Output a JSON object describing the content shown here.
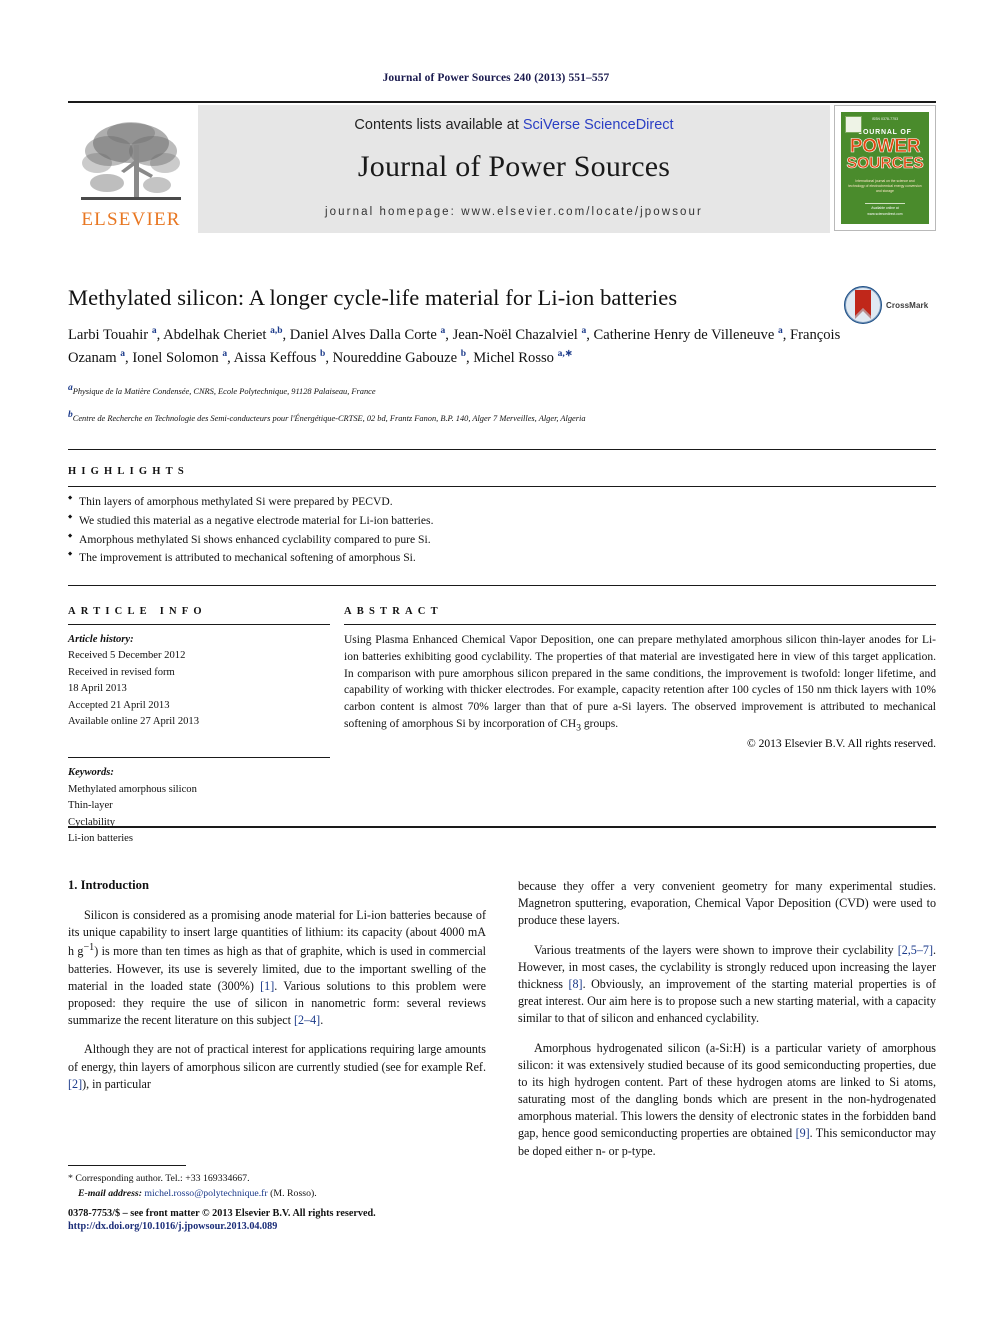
{
  "running_head": "Journal of Power Sources 240 (2013) 551–557",
  "masthead": {
    "publisher_logo_name": "elsevier-tree-logo",
    "publisher_wordmark": "ELSEVIER",
    "contents_prefix": "Contents lists available at ",
    "contents_link": "SciVerse ScienceDirect",
    "journal_name": "Journal of Power Sources",
    "homepage_line": "journal homepage: www.elsevier.com/locate/jpowsour",
    "cover": {
      "top_text": "ISSN 0378-7753",
      "line1": "JOURNAL OF",
      "line2": "POWER",
      "line3": "SOURCES",
      "blurb": "International journal on the science and technology of electrochemical energy conversion and storage",
      "bottom_line1": "Available online at",
      "bottom_line2": "www.sciencedirect.com"
    },
    "accent_orange": "#E87722",
    "link_blue": "#2b3fc4",
    "contents_bg": "#e6e6e6",
    "cover_green": "#4a8b2c"
  },
  "article": {
    "title": "Methylated silicon: A longer cycle-life material for Li-ion batteries",
    "crossmark_label": "CrossMark",
    "authors_html": "Larbi Touahir <sup>a</sup>, Abdelhak Cheriet <sup>a,b</sup>, Daniel Alves Dalla Corte <sup>a</sup>, Jean-Noël Chazalviel <sup>a</sup>, Catherine Henry de Villeneuve <sup>a</sup>, François Ozanam <sup>a</sup>, Ionel Solomon <sup>a</sup>, Aissa Keffous <sup>b</sup>, Noureddine Gabouze <sup>b</sup>, Michel Rosso <sup>a,∗</sup>",
    "affiliation_a": "Physique de la Matière Condensée, CNRS, Ecole Polytechnique, 91128 Palaiseau, France",
    "affiliation_b": "Centre de Recherche en Technologie des Semi-conducteurs pour l'Énergétique-CRTSE, 02 bd, Frantz Fanon, B.P. 140, Alger 7 Merveilles, Alger, Algeria"
  },
  "highlights": {
    "heading": "HIGHLIGHTS",
    "items": [
      "Thin layers of amorphous methylated Si were prepared by PECVD.",
      "We studied this material as a negative electrode material for Li-ion batteries.",
      "Amorphous methylated Si shows enhanced cyclability compared to pure Si.",
      "The improvement is attributed to mechanical softening of amorphous Si."
    ]
  },
  "article_info": {
    "heading": "ARTICLE INFO",
    "history_label": "Article history:",
    "history": [
      "Received 5 December 2012",
      "Received in revised form",
      "18 April 2013",
      "Accepted 21 April 2013",
      "Available online 27 April 2013"
    ],
    "keywords_label": "Keywords:",
    "keywords": [
      "Methylated amorphous silicon",
      "Thin-layer",
      "Cyclability",
      "Li-ion batteries"
    ]
  },
  "abstract": {
    "heading": "ABSTRACT",
    "text_html": "Using Plasma Enhanced Chemical Vapor Deposition, one can prepare methylated amorphous silicon thin-layer anodes for Li-ion batteries exhibiting good cyclability. The properties of that material are investigated here in view of this target application. In comparison with pure amorphous silicon prepared in the same conditions, the improvement is twofold: longer lifetime, and capability of working with thicker electrodes. For example, capacity retention after 100 cycles of 150 nm thick layers with 10% carbon content is almost 70% larger than that of pure a-Si layers. The observed improvement is attributed to mechanical softening of amorphous Si by incorporation of CH<sub>3</sub> groups.",
    "rights": "© 2013 Elsevier B.V. All rights reserved."
  },
  "body": {
    "section_number_title": "1. Introduction",
    "left_paragraphs_html": [
      "Silicon is considered as a promising anode material for Li-ion batteries because of its unique capability to insert large quantities of lithium: its capacity (about 4000 mA h g<sup>−1</sup>) is more than ten times as high as that of graphite, which is used in commercial batteries. However, its use is severely limited, due to the important swelling of the material in the loaded state (300%) <span class=\"ref\">[1]</span>. Various solutions to this problem were proposed: they require the use of silicon in nanometric form: several reviews summarize the recent literature on this subject <span class=\"ref\">[2–4]</span>.",
      "Although they are not of practical interest for applications requiring large amounts of energy, thin layers of amorphous silicon are currently studied (see for example Ref. <span class=\"ref\">[2]</span>), in particular"
    ],
    "right_paragraphs_html": [
      "because they offer a very convenient geometry for many experimental studies. Magnetron sputtering, evaporation, Chemical Vapor Deposition (CVD) were used to produce these layers.",
      "Various treatments of the layers were shown to improve their cyclability <span class=\"ref\">[2,5–7]</span>. However, in most cases, the cyclability is strongly reduced upon increasing the layer thickness <span class=\"ref\">[8]</span>. Obviously, an improvement of the starting material properties is of great interest. Our aim here is to propose such a new starting material, with a capacity similar to that of silicon and enhanced cyclability.",
      "Amorphous hydrogenated silicon (a-Si:H) is a particular variety of amorphous silicon: it was extensively studied because of its good semiconducting properties, due to its high hydrogen content. Part of these hydrogen atoms are linked to Si atoms, saturating most of the dangling bonds which are present in the non-hydrogenated amorphous material. This lowers the density of electronic states in the forbidden band gap, hence good semiconducting properties are obtained <span class=\"ref\">[9]</span>. This semiconductor may be doped either n- or p-type."
    ]
  },
  "footnote": {
    "corresponding_html": "* Corresponding author. Tel.: +33 169334667.",
    "email_html": "<span class=\"fn-ital\">E-mail address:</span> <span class=\"mail\">michel.rosso@polytechnique.fr</span> (M. Rosso)."
  },
  "page_footer": {
    "issn_line": "0378-7753/$ – see front matter © 2013 Elsevier B.V. All rights reserved.",
    "doi_line": "http://dx.doi.org/10.1016/j.jpowsour.2013.04.089"
  }
}
